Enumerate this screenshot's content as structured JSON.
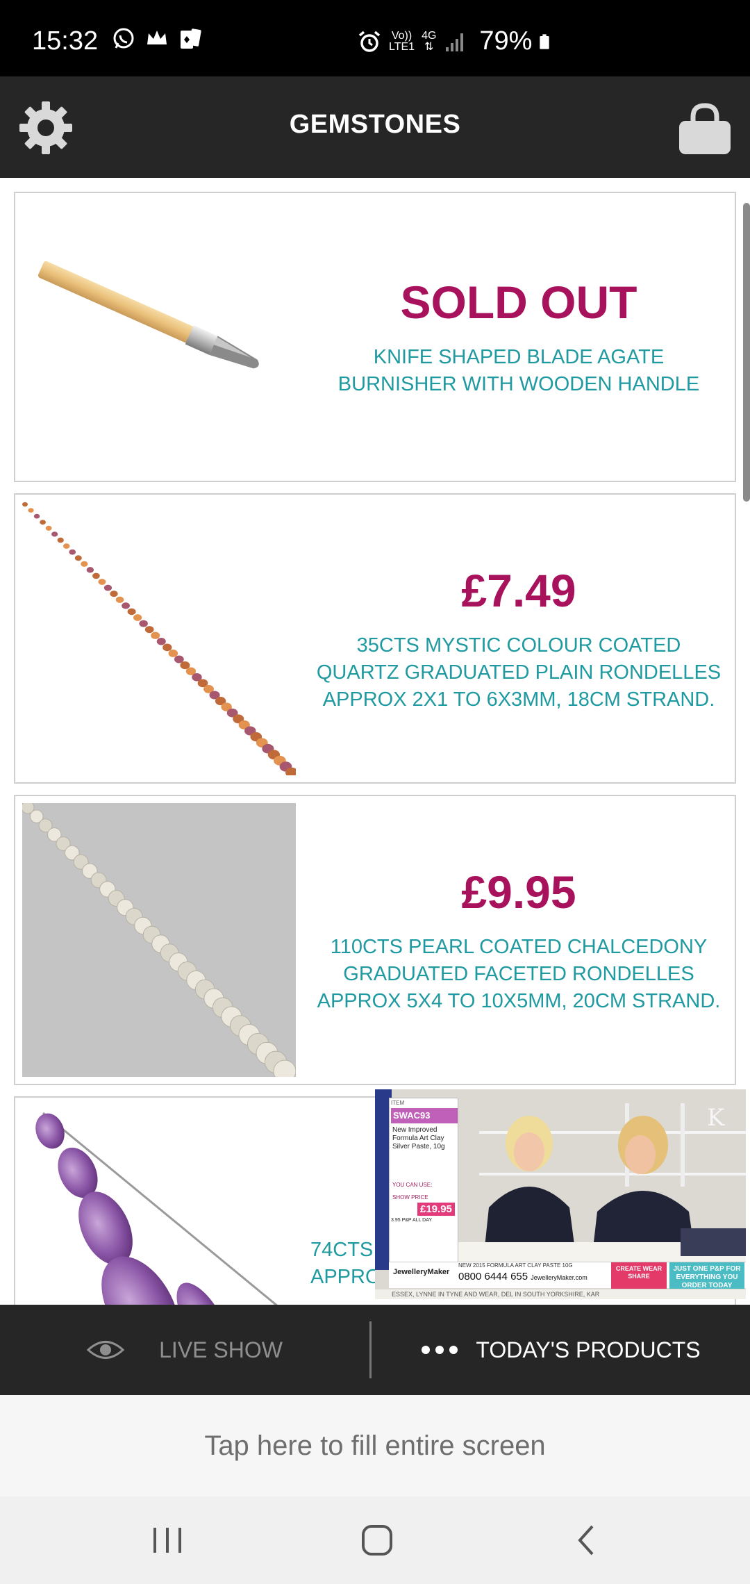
{
  "status_bar": {
    "time": "15:32",
    "network_top": "Vo))",
    "network_bottom": "LTE1",
    "network_type": "4G",
    "battery": "79%"
  },
  "header": {
    "title": "GEMSTONES"
  },
  "products": [
    {
      "price": "SOLD OUT",
      "description": "KNIFE SHAPED BLADE AGATE BURNISHER WITH WOODEN HANDLE"
    },
    {
      "price": "£7.49",
      "description": "35CTS MYSTIC COLOUR COATED QUARTZ GRADUATED PLAIN RONDELLES APPROX 2X1 TO 6X3MM, 18CM STRAND."
    },
    {
      "price": "£9.95",
      "description": "110CTS PEARL COATED CHALCEDONY GRADUATED FACETED RONDELLES APPROX 5X4 TO 10X5MM, 20CM STRAND."
    },
    {
      "price": "",
      "description_line1": "74CTS C",
      "description_line2": "APPRO"
    }
  ],
  "video_overlay": {
    "item_code": "SWAC93",
    "item_text": "New Improved Formula Art Clay Silver Paste, 10g",
    "you_can_use": "YOU CAN USE:",
    "show_price_label": "SHOW PRICE",
    "show_price": "£19.95",
    "pp_note": "3.95 P&P ALL DAY",
    "brand": "JewelleryMaker",
    "headline": "NEW 2015 FORMULA ART CLAY PASTE 10G",
    "phone": "0800 6444 655",
    "site": "JewelleryMaker.com",
    "promo1": "CREATE WEAR SHARE",
    "promo2": "JUST ONE P&P FOR EVERYTHING YOU ORDER TODAY",
    "crawl": "ESSEX,   LYNNE IN TYNE AND WEAR,   DEL IN SOUTH YORKSHIRE,   KAR"
  },
  "bottom_tabs": {
    "live_show": "LIVE SHOW",
    "todays_products": "TODAY'S PRODUCTS"
  },
  "fill_screen": {
    "label": "Tap here to fill entire screen"
  },
  "colors": {
    "header_bg": "#262626",
    "price": "#a8125c",
    "description": "#1f9aa0"
  }
}
